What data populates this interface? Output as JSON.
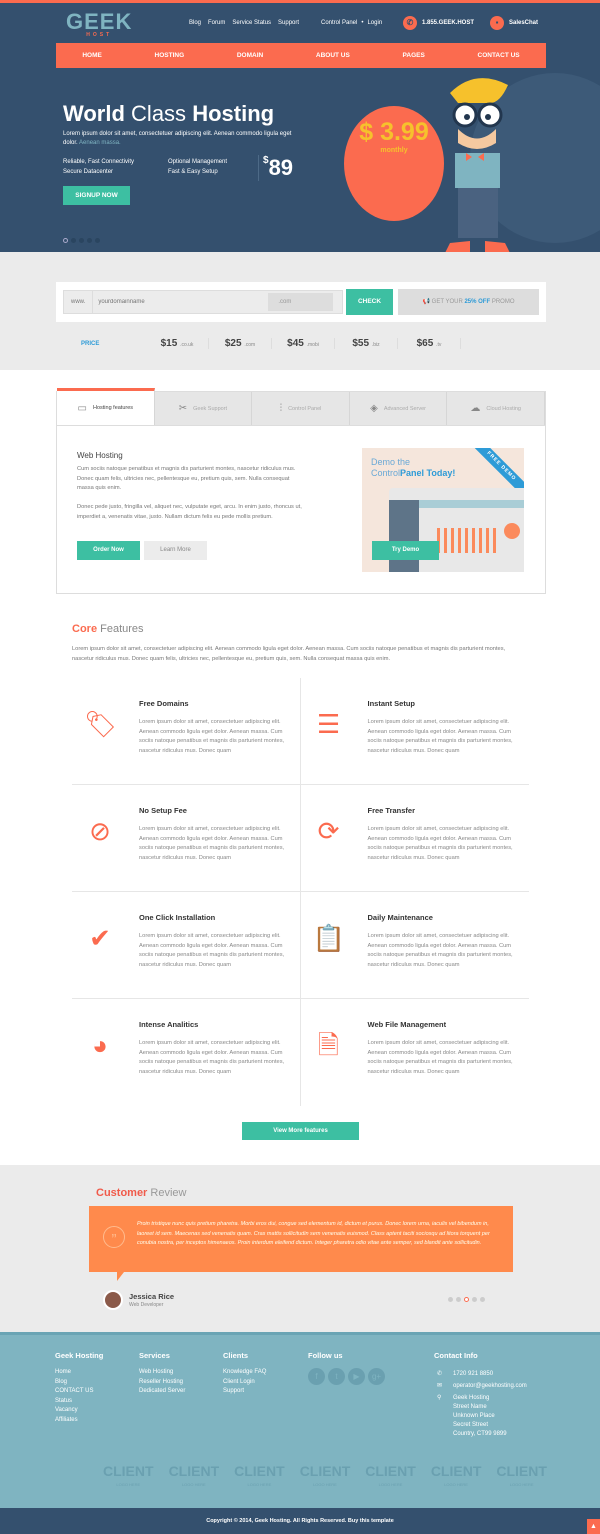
{
  "colors": {
    "accent": "#fb6b4f",
    "teal": "#3dbfa2",
    "navy": "#34506e",
    "footer": "#7fb4c1",
    "review": "#ff8a4c",
    "blue": "#2e9bd7"
  },
  "header": {
    "logo_main": "GEEK",
    "logo_sub": "HOST",
    "links": [
      "Blog",
      "Forum",
      "Service Status",
      "Support"
    ],
    "control_panel": "Control Panel",
    "login": "Login",
    "phone": "1.855.GEEK.HOST",
    "chat": "SalesChat"
  },
  "nav": [
    "HOME",
    "HOSTING",
    "DOMAIN",
    "ABOUT US",
    "PAGES",
    "CONTACT US"
  ],
  "hero": {
    "title_a": "World",
    "title_b": "Class",
    "title_c": "Hosting",
    "sub": "Lorem ipsum dolor sit amet, consectetuer adipiscing elit. Aenean commodo ligula eget dolor.",
    "sub_link": "Aenean massa.",
    "features_left": [
      "Reliable, Fast Connectivity",
      "Secure Datacenter"
    ],
    "features_right": [
      "Optional Management",
      "Fast & Easy Setup"
    ],
    "price_symbol": "$",
    "price": "89",
    "badge_price": "$ 3.99",
    "badge_period": "monthly",
    "cta": "SIGNUP NOW",
    "slides": 5,
    "active_slide": 1
  },
  "domain": {
    "prefix": "www.",
    "placeholder": "yourdomainname",
    "tld": ".com",
    "check": "CHECK",
    "promo_a": "GET YOUR",
    "promo_b": "25% OFF",
    "promo_c": "PROMO",
    "price_label": "PRICE",
    "prices": [
      {
        "p": "$15",
        "t": ".co.uk"
      },
      {
        "p": "$25",
        "t": ".com"
      },
      {
        "p": "$45",
        "t": ".mobi"
      },
      {
        "p": "$55",
        "t": ".biz"
      },
      {
        "p": "$65",
        "t": ".tv"
      }
    ]
  },
  "tabs": [
    {
      "label": "Hosting features",
      "icon": "browser-icon"
    },
    {
      "label": "Geek Support",
      "icon": "tools-icon"
    },
    {
      "label": "Control Panel",
      "icon": "sliders-icon"
    },
    {
      "label": "Advanced Server",
      "icon": "layers-icon"
    },
    {
      "label": "Cloud Hosting",
      "icon": "cloud-icon"
    }
  ],
  "tab_content": {
    "title": "Web Hosting",
    "p1": "Cum sociis natoque penatibus et magnis dis parturient montes, nascetur ridiculus mus. Donec quam felis, ultricies nec, pellentesque eu, pretium quis, sem. Nulla consequat massa quis enim.",
    "p2": "Donec pede justo, fringilla vel, aliquet nec, vulputate eget, arcu. In enim justo, rhoncus ut, imperdiet a, venenatis vitae, justo. Nullam dictum felis eu pede mollis pretium.",
    "order": "Order Now",
    "learn": "Learn More",
    "demo_a": "Demo the",
    "demo_b": "Control",
    "demo_c": "Panel Today!",
    "ribbon": "FREE DEMO",
    "try": "Try Demo"
  },
  "core": {
    "title_a": "Core",
    "title_b": "Features",
    "intro": "Lorem ipsum dolor sit amet, consectetuer adipiscing elit. Aenean commodo ligula eget dolor. Aenean massa. Cum sociis natoque penatibus et magnis dis parturient montes, nascetur ridiculus mus. Donec quam felis, ultricies nec, pellentesque eu, pretium quis, sem. Nulla consequat massa quis enim.",
    "items": [
      {
        "title": "Free Domains",
        "icon": "free-domain-icon",
        "glyph": "🏷",
        "text": "Lorem ipsum dolor sit amet, consectetuer adipiscing elit. Aenean commodo ligula eget dolor. Aenean massa. Cum sociis natoque penatibus et magnis dis parturient montes, nascetur ridiculus mus. Donec quam"
      },
      {
        "title": "Instant Setup",
        "icon": "instant-setup-icon",
        "glyph": "☰",
        "text": "Lorem ipsum dolor sit amet, consectetuer adipiscing elit. Aenean commodo ligula eget dolor. Aenean massa. Cum sociis natoque penatibus et magnis dis parturient montes, nascetur ridiculus mus. Donec quam"
      },
      {
        "title": "No Setup Fee",
        "icon": "no-fee-icon",
        "glyph": "⊘",
        "text": "Lorem ipsum dolor sit amet, consectetuer adipiscing elit. Aenean commodo ligula eget dolor. Aenean massa. Cum sociis natoque penatibus et magnis dis parturient montes, nascetur ridiculus mus. Donec quam"
      },
      {
        "title": "Free Transfer",
        "icon": "transfer-icon",
        "glyph": "⟳",
        "text": "Lorem ipsum dolor sit amet, consectetuer adipiscing elit. Aenean commodo ligula eget dolor. Aenean massa. Cum sociis natoque penatibus et magnis dis parturient montes, nascetur ridiculus mus. Donec quam"
      },
      {
        "title": "One Click Installation",
        "icon": "click-install-icon",
        "glyph": "✔",
        "text": "Lorem ipsum dolor sit amet, consectetuer adipiscing elit. Aenean commodo ligula eget dolor. Aenean massa. Cum sociis natoque penatibus et magnis dis parturient montes, nascetur ridiculus mus. Donec quam"
      },
      {
        "title": "Daily Maintenance",
        "icon": "clipboard-icon",
        "glyph": "📋",
        "text": "Lorem ipsum dolor sit amet, consectetuer adipiscing elit. Aenean commodo ligula eget dolor. Aenean massa. Cum sociis natoque penatibus et magnis dis parturient montes, nascetur ridiculus mus. Donec quam"
      },
      {
        "title": "Intense Analitics",
        "icon": "pie-chart-icon",
        "glyph": "◕",
        "text": "Lorem ipsum dolor sit amet, consectetuer adipiscing elit. Aenean commodo ligula eget dolor. Aenean massa. Cum sociis natoque penatibus et magnis dis parturient montes, nascetur ridiculus mus. Donec quam"
      },
      {
        "title": "Web File Management",
        "icon": "files-icon",
        "glyph": "🗎",
        "text": "Lorem ipsum dolor sit amet, consectetuer adipiscing elit. Aenean commodo ligula eget dolor. Aenean massa. Cum sociis natoque penatibus et magnis dis parturient montes, nascetur ridiculus mus. Donec quam"
      }
    ],
    "more": "View More features"
  },
  "review": {
    "title_a": "Customer",
    "title_b": "Review",
    "text": "Proin tristique nunc quis pretium pharetra. Morbi eros dui, congue sed elementum id, dictum et purus. Donec lorem urna, iaculis vel bibendum in, laoreet id sem. Maecenas sed venenatis quam. Cras mattis sollicitudin sem venenatis euismod. Class aptent taciti sociosqu ad litora torquent per conubia nostra, per inceptos himenaeos. Proin interdum eleifend dictum. Integer pharetra odio vitae ante semper, sed blandit ante sollicitudin.",
    "name": "Jessica Rice",
    "role": "Web Developer",
    "slides": 5,
    "active_slide": 3
  },
  "footer": {
    "col1": {
      "title": "Geek Hosting",
      "links": [
        "Home",
        "Blog",
        "CONTACT US",
        "Status",
        "Vacancy",
        "Affiliates"
      ]
    },
    "col2": {
      "title": "Services",
      "links": [
        "Web Hosting",
        "Reseller Hosting",
        "Dedicated Server"
      ]
    },
    "col3": {
      "title": "Clients",
      "links": [
        "Knowledge FAQ",
        "Client Login",
        "Support"
      ]
    },
    "follow": "Follow us",
    "social": [
      "facebook-icon",
      "twitter-icon",
      "youtube-icon",
      "google-plus-icon"
    ],
    "contact_title": "Contact Info",
    "phone": "1720 921 8850",
    "email": "operator@geekhosting.com",
    "address": [
      "Geek Hosting",
      "Street Name",
      "Unknown Place",
      "Secret Street",
      "Country, CT99 9899"
    ],
    "client_logo": "CLIENT",
    "client_sub": "LOGO HERE",
    "client_count": 7,
    "copyright": "Copyright © 2014, Geek Hosting. All Rights Reserved. Buy this template"
  }
}
